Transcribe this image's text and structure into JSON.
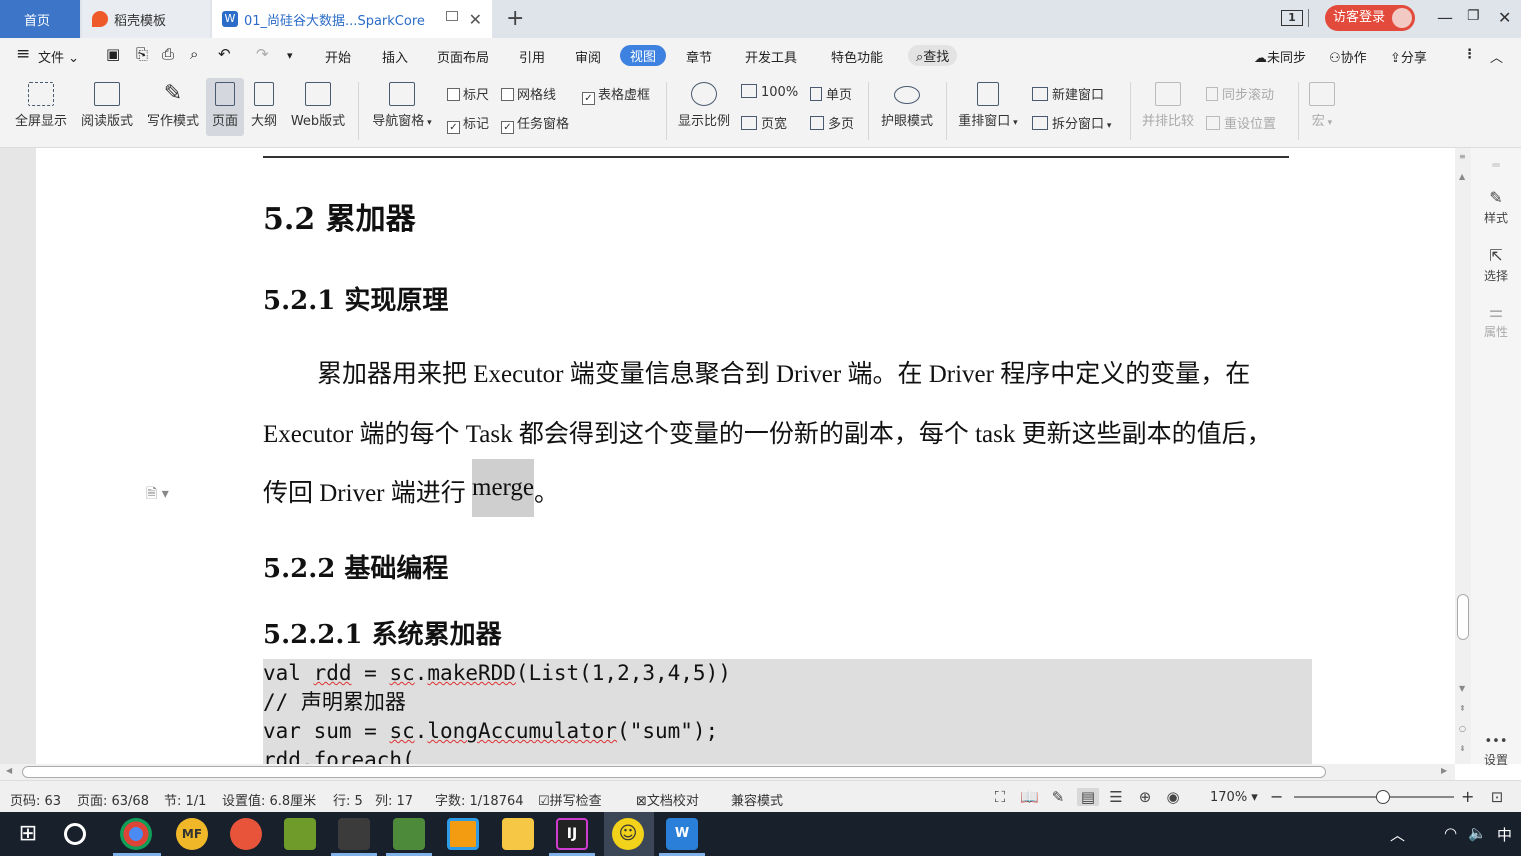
{
  "tabs": {
    "home": "首页",
    "template": "稻壳模板",
    "document": "01_尚硅谷大数据...SparkCore"
  },
  "window": {
    "count_badge": "1",
    "login": "访客登录"
  },
  "menu": {
    "file": "文件",
    "items": [
      "开始",
      "插入",
      "页面布局",
      "引用",
      "审阅",
      "视图",
      "章节",
      "开发工具",
      "特色功能"
    ],
    "active": "视图",
    "search": "查找",
    "sync": "未同步",
    "collab": "协作",
    "share": "分享"
  },
  "ribbon": {
    "fullscreen": "全屏显示",
    "read_mode": "阅读版式",
    "write_mode": "写作模式",
    "page": "页面",
    "outline": "大纲",
    "web": "Web版式",
    "nav_pane": "导航窗格",
    "ruler": "标尺",
    "gridlines": "网格线",
    "table_frame": "表格虚框",
    "marker": "标记",
    "task_pane": "任务窗格",
    "zoom_ratio": "显示比例",
    "hundred": "100%",
    "page_width": "页宽",
    "single_page": "单页",
    "multi_page": "多页",
    "eye_mode": "护眼模式",
    "rearrange": "重排窗口",
    "new_window": "新建窗口",
    "split_window": "拆分窗口",
    "side_by_side": "并排比较",
    "sync_scroll": "同步滚动",
    "reset_pos": "重设位置",
    "macro": "宏"
  },
  "document": {
    "h_52": "5.2  累加器",
    "h_521": "5.2.1  实现原理",
    "p1_line1": "累加器用来把 Executor 端变量信息聚合到 Driver 端。在 Driver 程序中定义的变量，在",
    "p1_line2": "Executor 端的每个 Task 都会得到这个变量的一份新的副本，每个 task 更新这些副本的值后，",
    "p1_line3_a": "传回 Driver 端进行 ",
    "p1_line3_hl": "merge",
    "p1_line3_b": "。",
    "h_522": "5.2.2  基础编程",
    "h_5221": "5.2.2.1  系统累加器",
    "code": [
      "val rdd = sc.makeRDD(List(1,2,3,4,5))",
      "// 声明累加器",
      "var sum = sc.longAccumulator(\"sum\");",
      "rdd.foreach("
    ]
  },
  "sidebar": {
    "style": "样式",
    "select": "选择",
    "props": "属性",
    "settings": "设置"
  },
  "status": {
    "page_code": "页码: 63",
    "pages": "页面: 63/68",
    "section": "节: 1/1",
    "setting": "设置值: 6.8厘米",
    "row": "行: 5",
    "col": "列: 17",
    "words": "字数: 1/18764",
    "spell": "拼写检查",
    "proof": "文档校对",
    "compat": "兼容模式",
    "zoom": "170%"
  },
  "taskbar": {
    "ime": "中"
  }
}
